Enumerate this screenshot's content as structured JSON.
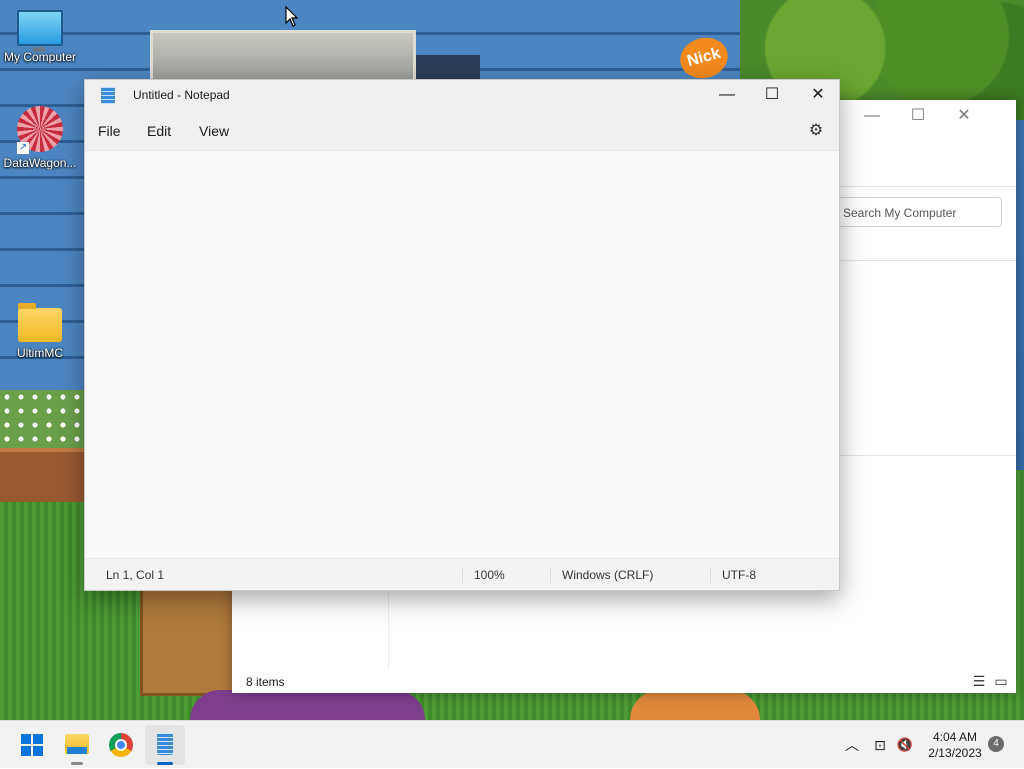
{
  "desktop": {
    "icons": [
      {
        "label": "My Computer",
        "icon": "monitor-icon"
      },
      {
        "label": "DataWagon...",
        "icon": "datawagon-icon"
      },
      {
        "label": "UltimMC",
        "icon": "folder-icon"
      }
    ]
  },
  "explorer": {
    "minimize_glyph": "—",
    "maximize_glyph": "☐",
    "close_glyph": "✕",
    "search_placeholder": "Search My Computer",
    "status_text": "8 items",
    "details_view_glyph": "☰",
    "tiles_view_glyph": "▭"
  },
  "notepad": {
    "title": "Untitled - Notepad",
    "minimize_glyph": "—",
    "maximize_glyph": "☐",
    "close_glyph": "✕",
    "menu": [
      "File",
      "Edit",
      "View"
    ],
    "settings_glyph": "⚙",
    "content": "",
    "status": {
      "position": "Ln 1, Col 1",
      "zoom": "100%",
      "line_endings": "Windows (CRLF)",
      "encoding": "UTF-8"
    }
  },
  "taskbar": {
    "apps": [
      {
        "name": "Start",
        "icon": "windows-start-icon",
        "active": false
      },
      {
        "name": "File Explorer",
        "icon": "file-explorer-icon",
        "active": false
      },
      {
        "name": "Google Chrome",
        "icon": "chrome-icon",
        "active": false
      },
      {
        "name": "Notepad",
        "icon": "notepad-icon",
        "active": true
      }
    ],
    "tray": {
      "chevron_glyph": "︿",
      "network_glyph": "⊡",
      "volume_glyph": "🔇"
    },
    "time": "4:04 AM",
    "date": "2/13/2023",
    "notification_count": "4"
  },
  "colors": {
    "accent": "#0067c0",
    "notepad_bg": "#f9f9f9",
    "taskbar_bg": "#f2f2f2"
  }
}
